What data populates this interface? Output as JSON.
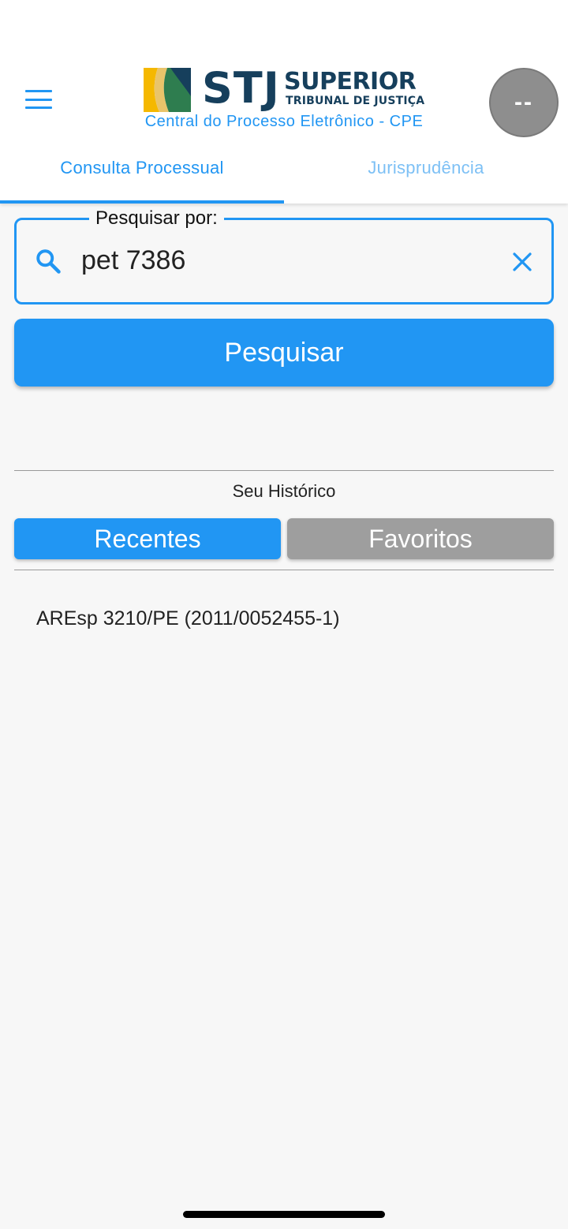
{
  "header": {
    "logo": {
      "abbr": "STJ",
      "name_line1": "SUPERIOR",
      "name_line2": "TRIBUNAL DE JUSTIÇA"
    },
    "subtitle": "Central do Processo Eletrônico - CPE",
    "avatar_text": "--",
    "icons": {
      "menu": "hamburger-menu-icon"
    }
  },
  "tabs": [
    {
      "label": "Consulta Processual",
      "active": true
    },
    {
      "label": "Jurisprudência",
      "active": false
    }
  ],
  "search": {
    "legend": "Pesquisar por:",
    "value": "pet 7386",
    "icons": {
      "search": "search-icon",
      "clear": "close-icon"
    },
    "button_label": "Pesquisar"
  },
  "history": {
    "title": "Seu Histórico",
    "segments": [
      {
        "label": "Recentes",
        "active": true
      },
      {
        "label": "Favoritos",
        "active": false
      }
    ],
    "items": [
      {
        "label": "AREsp 3210/PE (2011/0052455-1)"
      }
    ]
  },
  "colors": {
    "accent": "#2196f3",
    "inactive_tab": "#7dc0f5",
    "inactive_segment": "#9e9e9e",
    "logo_navy": "#163f5c",
    "avatar": "#8e8e8e"
  }
}
